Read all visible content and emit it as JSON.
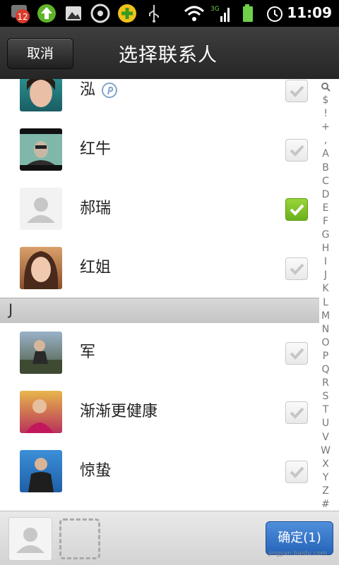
{
  "status_bar": {
    "notification_count": "12",
    "time": "11:09",
    "network": "3G"
  },
  "header": {
    "cancel_label": "取消",
    "title": "选择联系人"
  },
  "contacts": [
    {
      "name": "泓",
      "checked": false
    },
    {
      "name": "红牛",
      "checked": false
    },
    {
      "name": "郝瑞",
      "checked": true
    },
    {
      "name": "红姐",
      "checked": false
    },
    {
      "name": "军",
      "checked": false
    },
    {
      "name": "渐渐更健康",
      "checked": false
    },
    {
      "name": "惊蛰",
      "checked": false
    }
  ],
  "section_letter": "J",
  "index_letters": [
    "$",
    "!",
    "+",
    ",",
    "A",
    "B",
    "C",
    "D",
    "E",
    "F",
    "G",
    "H",
    "I",
    "J",
    "K",
    "L",
    "M",
    "N",
    "O",
    "P",
    "Q",
    "R",
    "S",
    "T",
    "U",
    "V",
    "W",
    "X",
    "Y",
    "Z",
    "#"
  ],
  "bottom": {
    "confirm_label": "确定(1)"
  },
  "watermark": "jingyan.baidu.com",
  "colors": {
    "accent_check": "#6bb11c",
    "confirm_button": "#2a6cc2"
  }
}
